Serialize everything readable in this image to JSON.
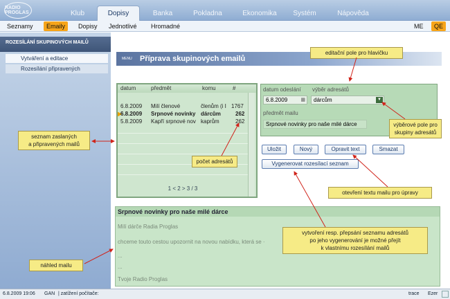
{
  "app": {
    "logo_text": "RADIO PROGLAS"
  },
  "main_tabs": [
    {
      "label": "Klub"
    },
    {
      "label": "Dopisy"
    },
    {
      "label": "Banka"
    },
    {
      "label": "Pokladna"
    },
    {
      "label": "Ekonomika"
    },
    {
      "label": "Systém"
    },
    {
      "label": "Nápověda"
    }
  ],
  "sub_tabs": [
    {
      "label": "Seznamy"
    },
    {
      "label": "Emaily"
    },
    {
      "label": "Dopisy"
    },
    {
      "label": "Jednotlivé"
    },
    {
      "label": "Hromadné"
    }
  ],
  "right_tabs": [
    "ME",
    "QE"
  ],
  "sidebar": {
    "header": "ROZESÍLÁNÍ SKUPINOVÝCH MAILŮ",
    "items": [
      {
        "label": "Vytváření a editace"
      },
      {
        "label": "Rozesílání připravených"
      }
    ]
  },
  "page": {
    "menu_label": "MENU",
    "title": "Příprava skupinových emailů"
  },
  "grid": {
    "columns": [
      "datum",
      "předmět",
      "komu",
      "#"
    ],
    "rows": [
      {
        "datum": "6.8.2009",
        "predmet": "Milí členové",
        "komu": "členům (i I",
        "count": "1767",
        "selected": false
      },
      {
        "datum": "6.8.2009",
        "predmet": "Srpnové novinky",
        "komu": "dárcům",
        "count": "262",
        "selected": true
      },
      {
        "datum": "5.8.2009",
        "predmet": "Kapří srpnové nov",
        "komu": "kaprům",
        "count": "262",
        "selected": false
      }
    ],
    "pager": "1 < 2 > 3 / 3"
  },
  "form": {
    "date_label": "datum odeslání",
    "date_value": "6.8.2009",
    "recipients_label": "výběr adresátů",
    "recipients_value": "dárcům",
    "subject_label": "předmět mailu",
    "subject_value": "Srpnové novinky pro naše milé dárce"
  },
  "buttons": {
    "save": "Uložit",
    "new": "Nový",
    "edit_text": "Opravit text",
    "delete": "Smazat",
    "generate": "Vygenerovat rozesílací seznam"
  },
  "preview": {
    "title": "Srpnové novinky pro naše milé dárce",
    "line1": "Milí dárče Radia Proglas",
    "line2": "chceme touto cestou upozornit na novou nabídku, která se ·",
    "line3": "...",
    "line4": "...",
    "line5": "Tvoje Radio Proglas"
  },
  "callouts": {
    "header_field": "editační pole pro hlavičku",
    "list": "seznam zaslaných\na připravených mailů",
    "count": "počet adresátů",
    "select_field": "výběrové pole pro\nskupiny adresátů",
    "open_text": "otevření textu mailu pro úpravy",
    "generate_info": "vytvoření resp. přepsání seznamu adresátů\npo jeho vygenerování je možné přejít\nk vlastnímu rozesílání mailů",
    "preview": "náhled mailu"
  },
  "status": {
    "datetime": "6.8.2009 19:06",
    "user": "GAN",
    "load": "| zatížení počítače:",
    "trace": "trace",
    "lang": "Ezer"
  },
  "colors": {
    "accent_tab": "#f7a51a",
    "grid_bg": "#cfe6cf",
    "callout_bg": "#f6eb86",
    "arrow": "#d0231a"
  }
}
